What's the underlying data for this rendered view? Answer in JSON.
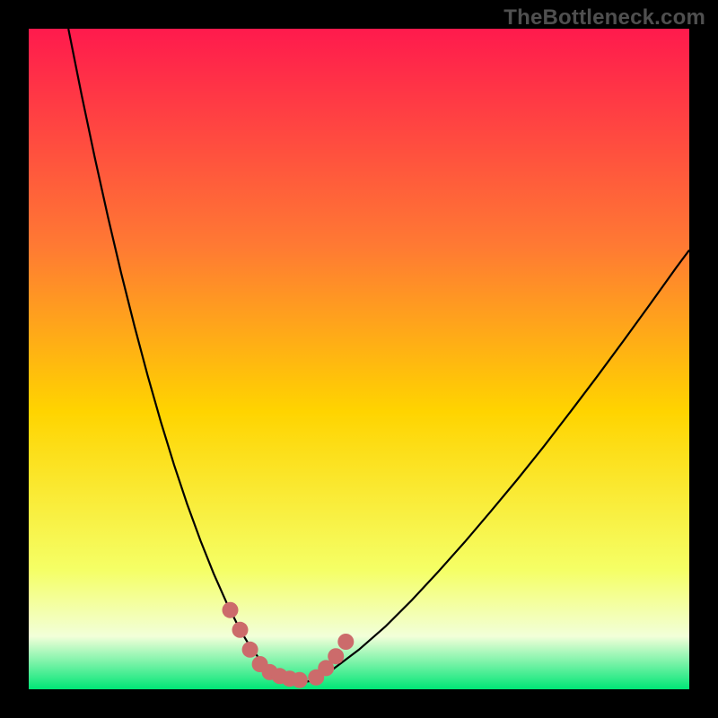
{
  "watermark": "TheBottleneck.com",
  "colors": {
    "frame": "#000000",
    "gradient_top": "#ff1a4d",
    "gradient_mid_upper": "#ff7a33",
    "gradient_mid": "#ffd400",
    "gradient_lower": "#f5ff66",
    "gradient_pale": "#f2ffd9",
    "gradient_bottom": "#00e676",
    "curve": "#000000",
    "marker": "#cc6b6b"
  },
  "chart_data": {
    "type": "line",
    "title": "",
    "xlabel": "",
    "ylabel": "",
    "xlim": [
      0,
      100
    ],
    "ylim": [
      0,
      100
    ],
    "grid": false,
    "series": [
      {
        "name": "bottleneck-curve",
        "x": [
          6,
          8,
          10,
          12,
          14,
          16,
          18,
          20,
          22,
          24,
          26,
          28,
          30,
          32,
          33.5,
          35,
          36.5,
          38,
          39.5,
          41,
          43,
          46,
          50,
          54,
          58,
          62,
          66,
          70,
          74,
          78,
          82,
          86,
          90,
          94,
          98,
          100
        ],
        "y": [
          100,
          90,
          80.5,
          71.5,
          63,
          55,
          47.5,
          40.5,
          34,
          28,
          22.5,
          17.5,
          13,
          9,
          6.5,
          4.5,
          3,
          2,
          1.3,
          1,
          1.3,
          3,
          6,
          9.5,
          13.5,
          17.8,
          22.3,
          27,
          31.8,
          36.8,
          42,
          47.3,
          52.7,
          58.2,
          63.8,
          66.5
        ]
      }
    ],
    "markers": {
      "name": "highlight-dots",
      "x": [
        30.5,
        32,
        33.5,
        35,
        36.5,
        38,
        39.5,
        41,
        43.5,
        45,
        46.5,
        48
      ],
      "y": [
        12,
        9,
        6,
        3.8,
        2.6,
        2,
        1.6,
        1.4,
        1.8,
        3.2,
        5,
        7.2
      ]
    }
  }
}
